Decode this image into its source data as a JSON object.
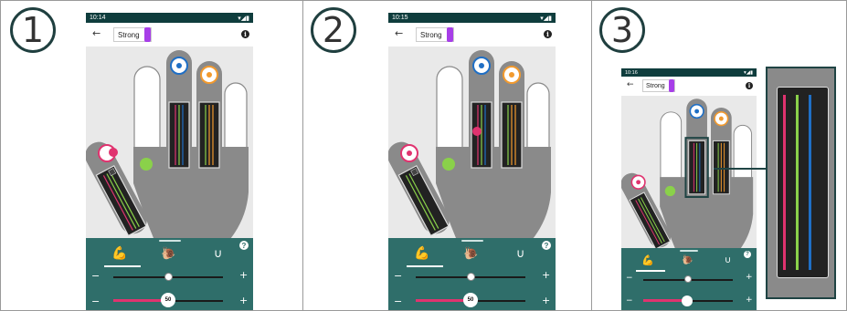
{
  "steps": [
    "1",
    "2",
    "3"
  ],
  "phones": [
    {
      "time": "10:14",
      "mode": "Strong",
      "value": "50"
    },
    {
      "time": "10:15",
      "mode": "Strong",
      "value": "50"
    },
    {
      "time": "10:16",
      "mode": "Strong"
    }
  ],
  "icons": {
    "back": "arrow-left-icon",
    "info": "info-icon",
    "help": "help-icon",
    "tools": [
      "muscle-arm-icon",
      "snail-icon",
      "magnet-icon"
    ]
  },
  "colors": {
    "status_bar": "#0f3d3d",
    "bottom_panel": "#2f6e6a",
    "mode_swatch": "#a73ee8",
    "electrode_blue": "#1f6fc5",
    "electrode_orange": "#f29a2e",
    "electrode_pink": "#e0336f",
    "green_dot": "#8ad14a",
    "hand": "#8a8a8a"
  }
}
